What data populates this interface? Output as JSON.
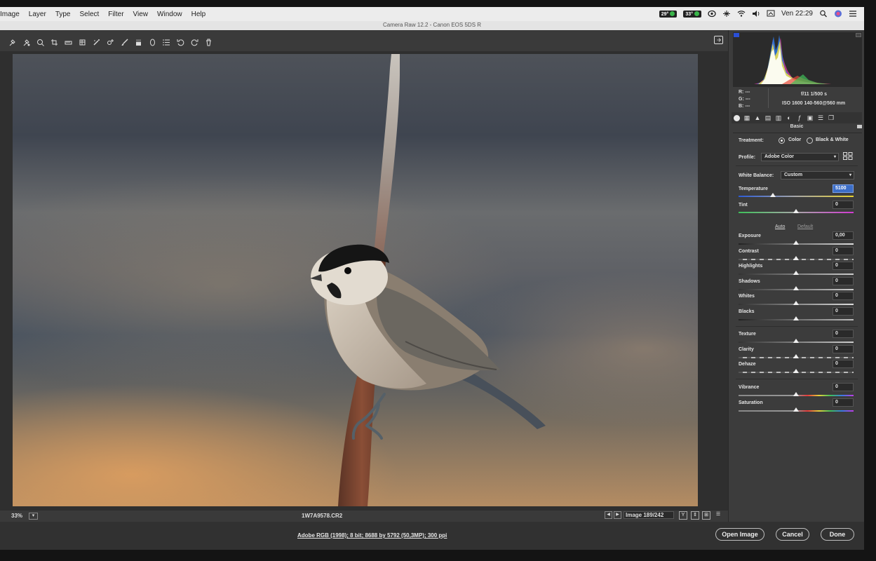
{
  "menubar": {
    "menus": [
      "Image",
      "Layer",
      "Type",
      "Select",
      "Filter",
      "View",
      "Window",
      "Help"
    ],
    "tray": {
      "temp1": "29°",
      "temp2": "33°",
      "clock": "Ven 22:29"
    }
  },
  "window": {
    "title": "Camera Raw 12.2  -  Canon EOS 5DS R"
  },
  "statusbar": {
    "zoom": "33%",
    "filename": "1W7A9578.CR2",
    "image_count": "Image 189/242"
  },
  "bottombar": {
    "workflow": "Adobe RGB (1998); 8 bit; 8688 by 5792 (50,3MP); 300 ppi",
    "open_label": "Open Image",
    "cancel_label": "Cancel",
    "done_label": "Done"
  },
  "info": {
    "r": "R:  ---",
    "g": "G:  ---",
    "b": "B:  ---",
    "aperture_shutter": "f/11   1/500 s",
    "iso_lens": "ISO 1600   140-560@560 mm"
  },
  "panel": {
    "title": "Basic",
    "treatment_label": "Treatment:",
    "treatment_color": "Color",
    "treatment_bw": "Black & White",
    "profile_label": "Profile:",
    "profile_value": "Adobe Color",
    "wb_label": "White Balance:",
    "wb_value": "Custom",
    "auto_label": "Auto",
    "default_label": "Default",
    "sliders": {
      "temperature": {
        "label": "Temperature",
        "value": "5100",
        "level": 0.3
      },
      "tint": {
        "label": "Tint",
        "value": "0",
        "level": 0.5
      },
      "exposure": {
        "label": "Exposure",
        "value": "0,00",
        "level": 0.5
      },
      "contrast": {
        "label": "Contrast",
        "value": "0",
        "level": 0.5
      },
      "highlights": {
        "label": "Highlights",
        "value": "0",
        "level": 0.5
      },
      "shadows": {
        "label": "Shadows",
        "value": "0",
        "level": 0.5
      },
      "whites": {
        "label": "Whites",
        "value": "0",
        "level": 0.5
      },
      "blacks": {
        "label": "Blacks",
        "value": "0",
        "level": 0.5
      },
      "texture": {
        "label": "Texture",
        "value": "0",
        "level": 0.5
      },
      "clarity": {
        "label": "Clarity",
        "value": "0",
        "level": 0.5
      },
      "dehaze": {
        "label": "Dehaze",
        "value": "0",
        "level": 0.5
      },
      "vibrance": {
        "label": "Vibrance",
        "value": "0",
        "level": 0.5
      },
      "saturation": {
        "label": "Saturation",
        "value": "0",
        "level": 0.5
      }
    }
  },
  "colors": {
    "panel_bg": "#3c3c3c",
    "canvas_bg": "#2f2f2f",
    "accent_blue": "#3c6ec8"
  }
}
